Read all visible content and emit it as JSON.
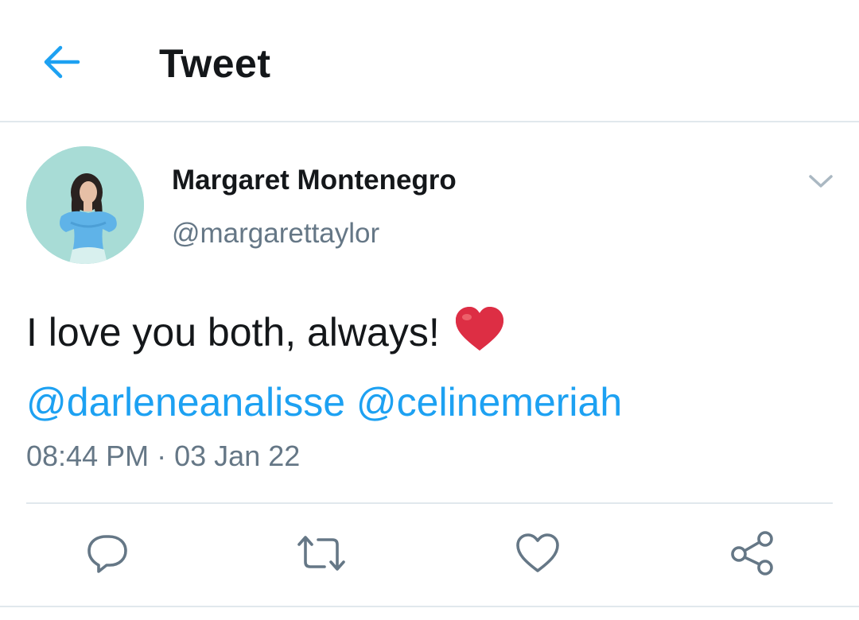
{
  "header": {
    "title": "Tweet",
    "back_icon": "arrow-left-icon"
  },
  "tweet": {
    "author": {
      "display_name": "Margaret Montenegro",
      "handle": "@margarettaylor"
    },
    "text": "I love you both, always!",
    "emoji": "red-heart",
    "mentions": [
      "@darleneanalisse",
      "@celinemeriah"
    ],
    "time": "08:44 PM",
    "separator": "·",
    "date": "03 Jan 22",
    "actions": [
      "reply-icon",
      "retweet-icon",
      "like-icon",
      "share-icon"
    ]
  },
  "colors": {
    "accent": "#1da1f2",
    "text": "#14171a",
    "secondary": "#657786",
    "divider": "#e1e8ed",
    "heart": "#e0245e"
  }
}
